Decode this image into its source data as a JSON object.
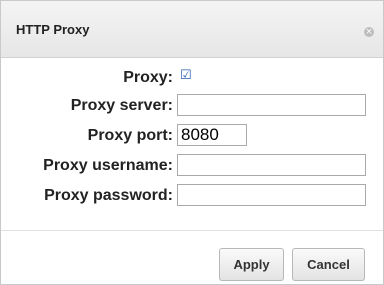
{
  "dialog": {
    "title": "HTTP Proxy",
    "close_glyph": "×"
  },
  "form": {
    "proxy": {
      "label": "Proxy:",
      "checked": true,
      "check_glyph": "☑"
    },
    "server": {
      "label": "Proxy server:",
      "value": ""
    },
    "port": {
      "label": "Proxy port:",
      "value": "8080"
    },
    "username": {
      "label": "Proxy username:",
      "value": ""
    },
    "password": {
      "label": "Proxy password:",
      "value": ""
    }
  },
  "buttons": {
    "apply": "Apply",
    "cancel": "Cancel"
  }
}
